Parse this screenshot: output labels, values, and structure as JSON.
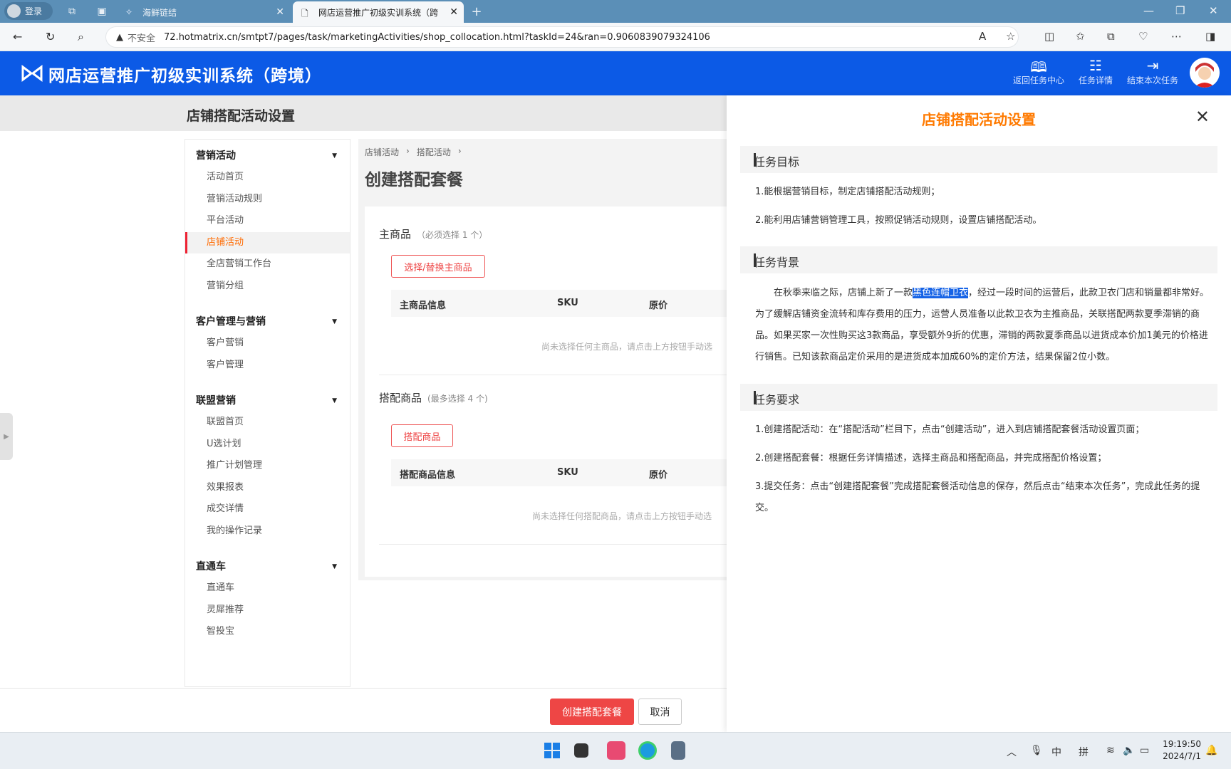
{
  "browser": {
    "profile_label": "登录",
    "tabs": [
      {
        "label": "海鲜链结"
      },
      {
        "label": "网店运营推广初级实训系统（跨"
      }
    ],
    "security_label": "不安全",
    "url": "72.hotmatrix.cn/smtpt7/pages/task/marketingActivities/shop_collocation.html?taskId=24&ran=0.9060839079324106"
  },
  "app": {
    "title": "网店运营推广初级实训系统（跨境）",
    "header_buttons": [
      {
        "label": "返回任务中心",
        "icon": "book-icon"
      },
      {
        "label": "任务详情",
        "icon": "list-icon"
      },
      {
        "label": "结束本次任务",
        "icon": "logout-icon"
      }
    ]
  },
  "page": {
    "title": "店铺搭配活动设置"
  },
  "sidebar": {
    "groups": [
      {
        "title": "营销活动",
        "items": [
          {
            "label": "活动首页"
          },
          {
            "label": "营销活动规则"
          },
          {
            "label": "平台活动"
          },
          {
            "label": "店铺活动",
            "active": true
          },
          {
            "label": "全店营销工作台"
          },
          {
            "label": "营销分组"
          }
        ]
      },
      {
        "title": "客户管理与营销",
        "items": [
          {
            "label": "客户营销"
          },
          {
            "label": "客户管理"
          }
        ]
      },
      {
        "title": "联盟营销",
        "items": [
          {
            "label": "联盟首页"
          },
          {
            "label": "U选计划"
          },
          {
            "label": "推广计划管理"
          },
          {
            "label": "效果报表"
          },
          {
            "label": "成交详情"
          },
          {
            "label": "我的操作记录"
          }
        ]
      },
      {
        "title": "直通车",
        "items": [
          {
            "label": "直通车"
          },
          {
            "label": "灵犀推荐"
          },
          {
            "label": "智投宝"
          }
        ]
      }
    ]
  },
  "content": {
    "breadcrumb": [
      "店铺活动",
      "›",
      "搭配活动",
      "›"
    ],
    "title": "创建搭配套餐",
    "main_section": {
      "title": "主商品",
      "hint": "（必须选择 1 个）",
      "button": "选择/替换主商品",
      "columns": [
        "主商品信息",
        "SKU",
        "原价"
      ],
      "empty": "尚未选择任何主商品，请点击上方按钮手动选"
    },
    "match_section": {
      "title": "搭配商品",
      "hint": "(最多选择 4 个)",
      "button": "搭配商品",
      "columns": [
        "搭配商品信息",
        "SKU",
        "原价"
      ],
      "empty": "尚未选择任何搭配商品，请点击上方按钮手动选"
    }
  },
  "footer": {
    "primary": "创建搭配套餐",
    "cancel": "取消"
  },
  "panel": {
    "title": "店铺搭配活动设置",
    "sections": [
      {
        "title": "任务目标",
        "paragraphs": [
          "1.能根据营销目标，制定店铺搭配活动规则；",
          "2.能利用店铺营销管理工具，按照促销活动规则，设置店铺搭配活动。"
        ]
      },
      {
        "title": "任务背景",
        "bg_before": "在秋季来临之际，店铺上新了一款",
        "bg_highlight": "黑色连帽卫衣",
        "bg_after": "，经过一段时间的运营后，此款卫衣门店和销量都非常好。为了缓解店铺资金流转和库存费用的压力，运营人员准备以此款卫衣为主推商品，关联搭配两款夏季滞销的商品。如果买家一次性购买这3款商品，享受额外9折的优惠，滞销的两款夏季商品以进货成本价加1美元的价格进行销售。已知该款商品定价采用的是进货成本加成60%的定价方法，结果保留2位小数。"
      },
      {
        "title": "任务要求",
        "paragraphs": [
          "1.创建搭配活动：在“搭配活动”栏目下，点击“创建活动”，进入到店铺搭配套餐活动设置页面；",
          "2.创建搭配套餐：根据任务详情描述，选择主商品和搭配商品，并完成搭配价格设置；",
          "3.提交任务：点击“创建搭配套餐”完成搭配套餐活动信息的保存，然后点击“结束本次任务”，完成此任务的提交。"
        ]
      }
    ]
  },
  "taskbar": {
    "ime_lang": "中",
    "ime_mode": "拼",
    "time": "19:19:50",
    "date": "2024/7/1"
  }
}
